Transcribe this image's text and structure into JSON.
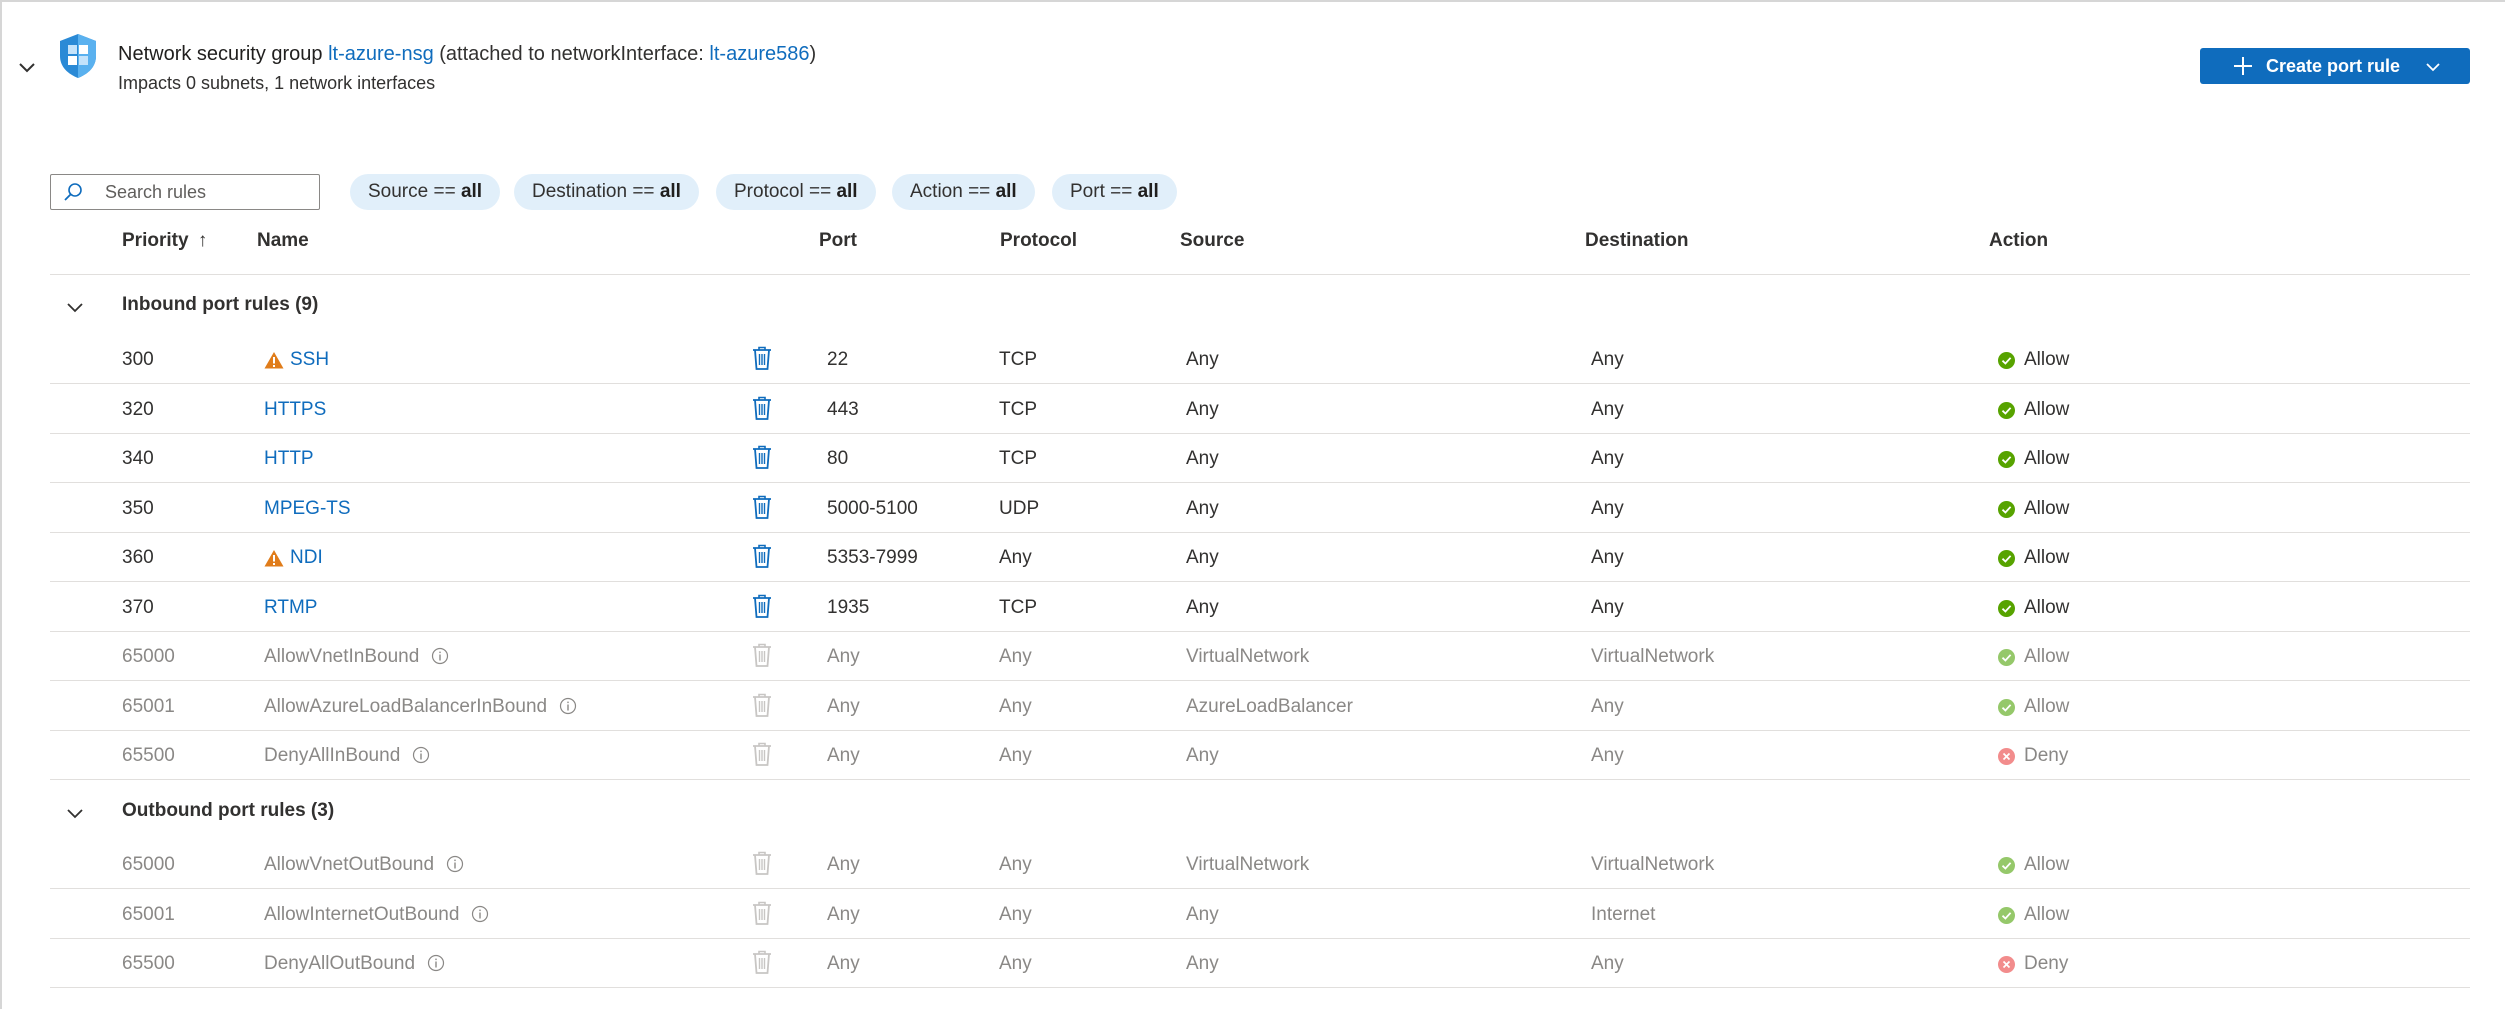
{
  "header": {
    "title_prefix": "Network security group",
    "nsg_name": "lt-azure-nsg",
    "attached_text": "(attached to networkInterface:",
    "nic_name": "lt-azure586",
    "close_paren": ")",
    "subtitle": "Impacts 0 subnets, 1 network interfaces",
    "create_button": "Create port rule"
  },
  "filters": {
    "search_placeholder": "Search rules",
    "pills": [
      {
        "key": "Source ==",
        "value": "all"
      },
      {
        "key": "Destination ==",
        "value": "all"
      },
      {
        "key": "Protocol ==",
        "value": "all"
      },
      {
        "key": "Action ==",
        "value": "all"
      },
      {
        "key": "Port ==",
        "value": "all"
      }
    ]
  },
  "columns": {
    "priority": "Priority",
    "priority_sort": "↑",
    "name": "Name",
    "port": "Port",
    "protocol": "Protocol",
    "source": "Source",
    "destination": "Destination",
    "action": "Action"
  },
  "inbound": {
    "label": "Inbound port rules (9)",
    "rules": [
      {
        "priority": "300",
        "name": "SSH",
        "port": "22",
        "protocol": "TCP",
        "source": "Any",
        "destination": "Any",
        "action": "Allow"
      },
      {
        "priority": "320",
        "name": "HTTPS",
        "port": "443",
        "protocol": "TCP",
        "source": "Any",
        "destination": "Any",
        "action": "Allow"
      },
      {
        "priority": "340",
        "name": "HTTP",
        "port": "80",
        "protocol": "TCP",
        "source": "Any",
        "destination": "Any",
        "action": "Allow"
      },
      {
        "priority": "350",
        "name": "MPEG-TS",
        "port": "5000-5100",
        "protocol": "UDP",
        "source": "Any",
        "destination": "Any",
        "action": "Allow"
      },
      {
        "priority": "360",
        "name": "NDI",
        "port": "5353-7999",
        "protocol": "Any",
        "source": "Any",
        "destination": "Any",
        "action": "Allow"
      },
      {
        "priority": "370",
        "name": "RTMP",
        "port": "1935",
        "protocol": "TCP",
        "source": "Any",
        "destination": "Any",
        "action": "Allow"
      },
      {
        "priority": "65000",
        "name": "AllowVnetInBound",
        "port": "Any",
        "protocol": "Any",
        "source": "VirtualNetwork",
        "destination": "VirtualNetwork",
        "action": "Allow"
      },
      {
        "priority": "65001",
        "name": "AllowAzureLoadBalancerInBound",
        "port": "Any",
        "protocol": "Any",
        "source": "AzureLoadBalancer",
        "destination": "Any",
        "action": "Allow"
      },
      {
        "priority": "65500",
        "name": "DenyAllInBound",
        "port": "Any",
        "protocol": "Any",
        "source": "Any",
        "destination": "Any",
        "action": "Deny"
      }
    ]
  },
  "outbound": {
    "label": "Outbound port rules (3)",
    "rules": [
      {
        "priority": "65000",
        "name": "AllowVnetOutBound",
        "port": "Any",
        "protocol": "Any",
        "source": "VirtualNetwork",
        "destination": "VirtualNetwork",
        "action": "Allow"
      },
      {
        "priority": "65001",
        "name": "AllowInternetOutBound",
        "port": "Any",
        "protocol": "Any",
        "source": "Any",
        "destination": "Internet",
        "action": "Allow"
      },
      {
        "priority": "65500",
        "name": "DenyAllOutBound",
        "port": "Any",
        "protocol": "Any",
        "source": "Any",
        "destination": "Any",
        "action": "Deny"
      }
    ]
  },
  "colors": {
    "accent": "#0f6cbd",
    "allow": "#57a300",
    "allow_muted": "#95c86a",
    "deny_muted": "#f28c8c",
    "warning": "#e07c1a",
    "pill_bg": "#e1effa"
  }
}
